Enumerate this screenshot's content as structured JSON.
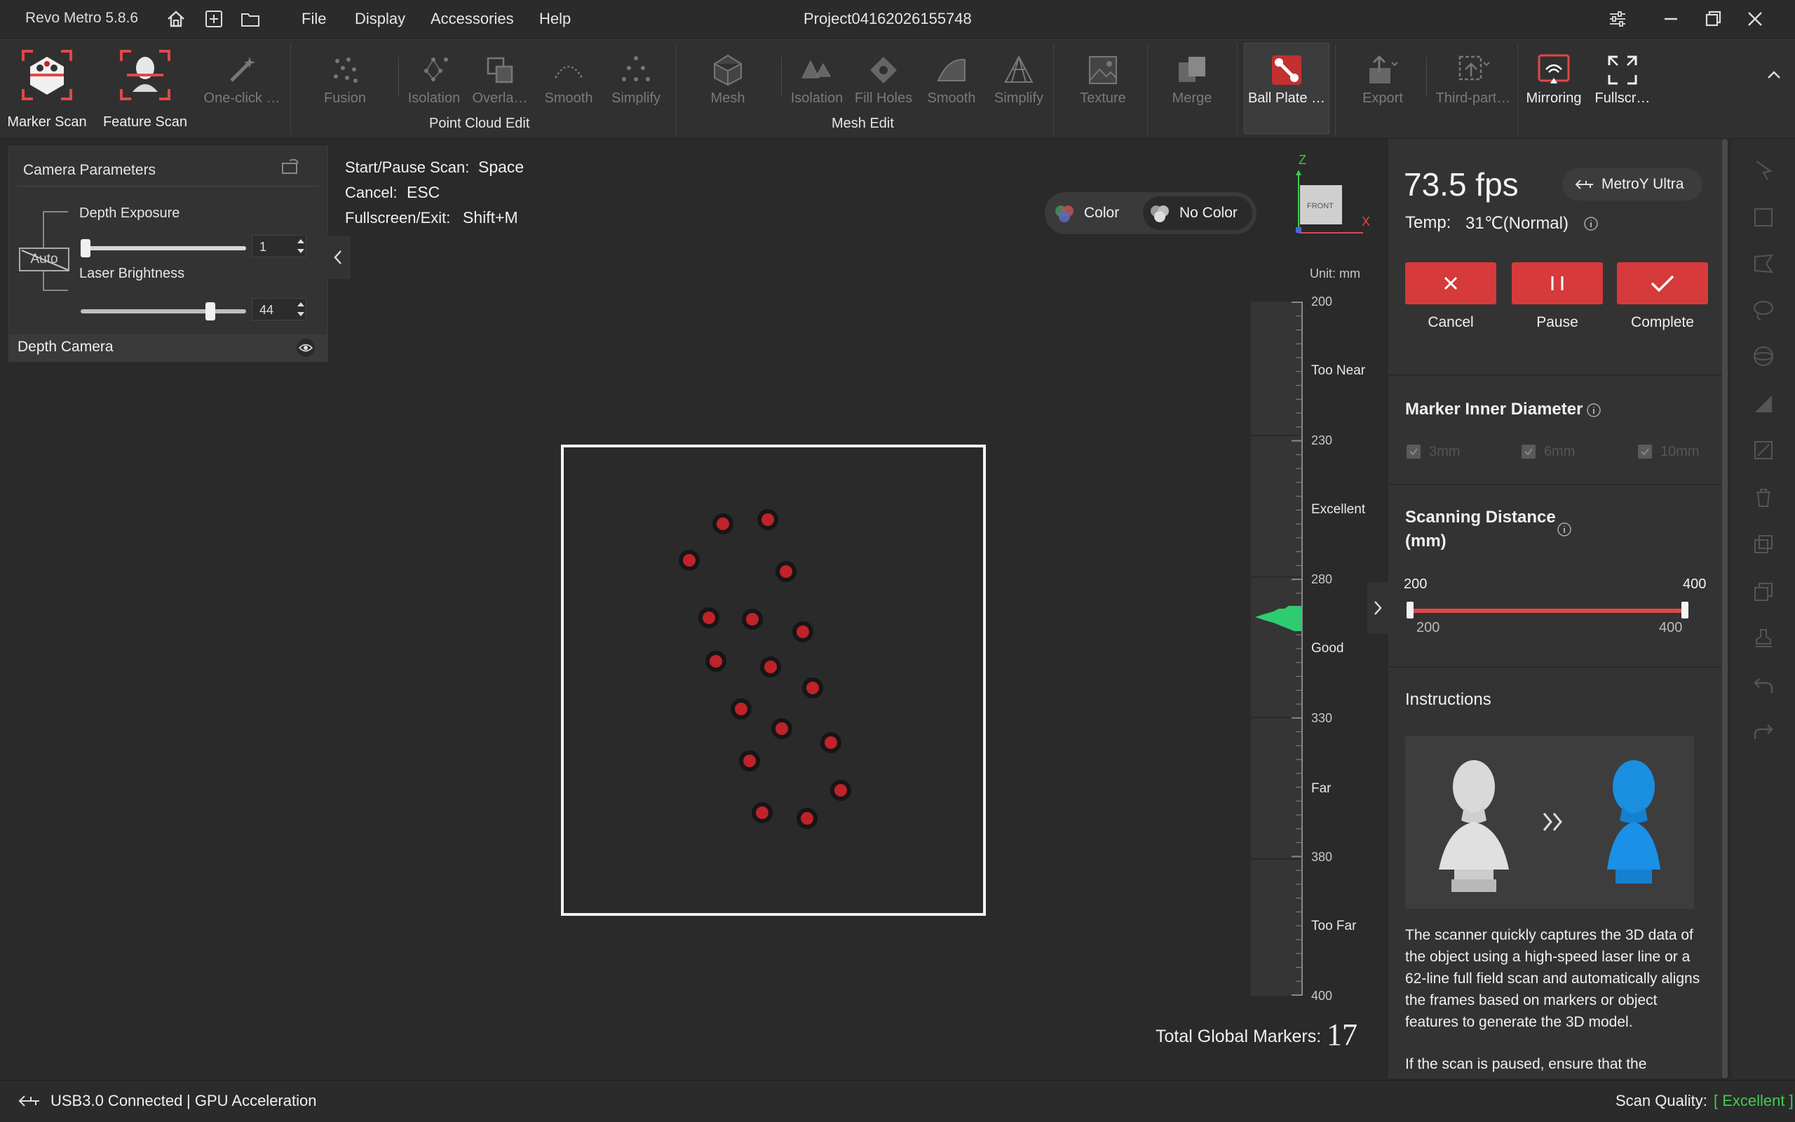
{
  "app": {
    "title": "Revo Metro 5.8.6",
    "project": "Project04162026155748"
  },
  "menu": [
    "File",
    "Display",
    "Accessories",
    "Help"
  ],
  "ribbon": {
    "marker_scan": "Marker Scan",
    "feature_scan": "Feature Scan",
    "one_click": "One-click …",
    "pc_fusion": "Fusion",
    "pc_isolation": "Isolation",
    "pc_overlap": "Overla…",
    "pc_smooth": "Smooth",
    "pc_simplify": "Simplify",
    "pc_group": "Point Cloud Edit",
    "mesh": "Mesh",
    "m_isolation": "Isolation",
    "m_fillholes": "Fill Holes",
    "m_smooth": "Smooth",
    "m_simplify": "Simplify",
    "mesh_group": "Mesh Edit",
    "texture": "Texture",
    "merge": "Merge",
    "ballplate": "Ball Plate …",
    "export": "Export",
    "thirdparty": "Third-part…",
    "mirroring": "Mirroring",
    "fullscreen": "Fullscr…"
  },
  "camera": {
    "title": "Camera Parameters",
    "auto": "Auto",
    "depth_exposure": "Depth Exposure",
    "depth_exposure_value": "1",
    "depth_exposure_level": 0.0,
    "laser_brightness": "Laser Brightness",
    "laser_brightness_value": "44",
    "laser_brightness_level": 0.8,
    "depth_camera": "Depth Camera"
  },
  "hints": {
    "start_label": "Start/Pause Scan:",
    "start_key": "Space",
    "cancel_label": "Cancel:",
    "cancel_key": "ESC",
    "full_label": "Fullscreen/Exit:",
    "full_key": "Shift+M"
  },
  "color_toggle": {
    "color": "Color",
    "nocolor": "No Color"
  },
  "axis": {
    "z": "Z",
    "x": "X",
    "front": "FRONT"
  },
  "ruler": {
    "unit": "Unit: mm",
    "ticks": [
      "200",
      "230",
      "280",
      "330",
      "380",
      "400"
    ],
    "zones": [
      "Too Near",
      "Excellent",
      "Good",
      "Far",
      "Too Far"
    ]
  },
  "markers_total_label": "Total Global Markers:",
  "markers_total": "17",
  "right": {
    "fps": "73.5 fps",
    "device": "MetroY Ultra",
    "temp_label": "Temp:",
    "temp_value": "31℃(Normal)",
    "cancel": "Cancel",
    "pause": "Pause",
    "complete": "Complete",
    "marker_title": "Marker Inner Diameter",
    "marker_opts": [
      "3mm",
      "6mm",
      "10mm"
    ],
    "dist_title_1": "Scanning Distance",
    "dist_title_2": "(mm)",
    "dist_min_top": "200",
    "dist_max_top": "400",
    "dist_min": "200",
    "dist_max": "400",
    "instructions_title": "Instructions",
    "instructions_text": "The scanner quickly captures the 3D data of the object using a high-speed laser line or a 62-line full field scan and automatically aligns the frames based on markers or object features to generate the 3D model.",
    "instructions_text2": "If the scan is paused, ensure that the"
  },
  "status": {
    "usb": "USB3.0 Connected",
    "gpu": "| GPU Acceleration",
    "quality_label": "Scan Quality:",
    "quality_value": "[ Excellent ]"
  },
  "colors": {
    "accent_red": "#d63a3a",
    "good_green": "#2ecc71",
    "quality_green": "#3ecf4a"
  }
}
